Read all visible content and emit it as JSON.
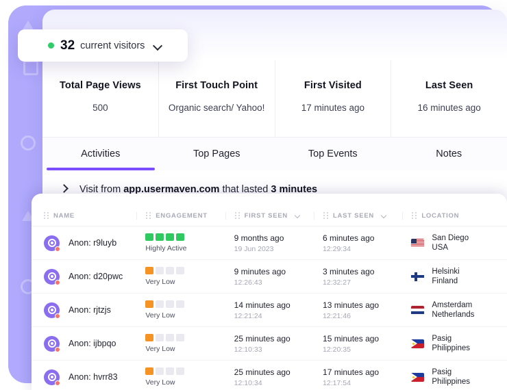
{
  "visitors_pill": {
    "count": "32",
    "label": "current visitors",
    "status_dot_color": "#2fce6b",
    "chevron": "chevron-down"
  },
  "metrics": [
    {
      "title": "Total Page Views",
      "value": "500"
    },
    {
      "title": "First Touch Point",
      "value": "Organic search/ Yahoo!"
    },
    {
      "title": "First Visited",
      "value": "17 minutes ago"
    },
    {
      "title": "Last Seen",
      "value": "16 minutes ago"
    }
  ],
  "tabs": [
    {
      "label": "Activities",
      "active": true
    },
    {
      "label": "Top Pages",
      "active": false
    },
    {
      "label": "Top Events",
      "active": false
    },
    {
      "label": "Notes",
      "active": false
    }
  ],
  "visit_row": {
    "prefix": "Visit from ",
    "domain": "app.usermaven.com",
    "middle": " that lasted ",
    "duration": "3 minutes"
  },
  "table": {
    "columns": [
      {
        "label": "NAME",
        "sortable": false
      },
      {
        "label": "ENGAGEMENT",
        "sortable": false
      },
      {
        "label": "FIRST SEEN",
        "sortable": true
      },
      {
        "label": "LAST SEEN",
        "sortable": true
      },
      {
        "label": "LOCATION",
        "sortable": false
      }
    ],
    "rows": [
      {
        "name": "Anon: r9luyb",
        "engagement_level": "Highly Active",
        "engagement_filled": 4,
        "engagement_color": "#2ec95f",
        "first_seen": "9 months ago",
        "first_seen_time": "19 Jun 2023",
        "last_seen": "6 minutes ago",
        "last_seen_time": "12:29:34",
        "city": "San Diego",
        "country": "USA",
        "flag": "us"
      },
      {
        "name": "Anon: d20pwc",
        "engagement_level": "Very Low",
        "engagement_filled": 1,
        "engagement_color": "#f59324",
        "first_seen": "9 minutes ago",
        "first_seen_time": "12:26:43",
        "last_seen": "3 minutes ago",
        "last_seen_time": "12:32:27",
        "city": "Helsinki",
        "country": "Finland",
        "flag": "fi"
      },
      {
        "name": "Anon: rjtzjs",
        "engagement_level": "Very Low",
        "engagement_filled": 1,
        "engagement_color": "#f59324",
        "first_seen": "14 minutes ago",
        "first_seen_time": "12:21:24",
        "last_seen": "13 minutes ago",
        "last_seen_time": "12:21:46",
        "city": "Amsterdam",
        "country": "Netherlands",
        "flag": "nl"
      },
      {
        "name": "Anon: ijbpqo",
        "engagement_level": "Very Low",
        "engagement_filled": 1,
        "engagement_color": "#f59324",
        "first_seen": "25 minutes ago",
        "first_seen_time": "12:10:33",
        "last_seen": "15 minutes ago",
        "last_seen_time": "12:20:35",
        "city": "Pasig",
        "country": "Philippines",
        "flag": "ph"
      },
      {
        "name": "Anon: hvrr83",
        "engagement_level": "Very Low",
        "engagement_filled": 1,
        "engagement_color": "#f59324",
        "first_seen": "25 minutes ago",
        "first_seen_time": "12:10:34",
        "last_seen": "17 minutes ago",
        "last_seen_time": "12:17:54",
        "city": "Pasig",
        "country": "Philippines",
        "flag": "ph"
      }
    ]
  },
  "theme": {
    "accent": "#7c4dff",
    "panel_purple": "#b0a9fc",
    "avatar_purple": "#8b6df0",
    "avatar_dot": "#f4736e"
  }
}
